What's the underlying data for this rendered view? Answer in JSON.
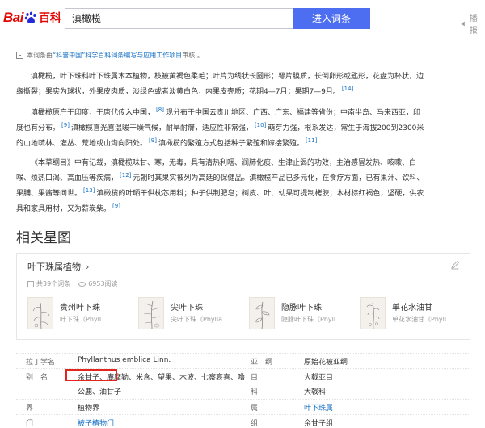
{
  "header": {
    "logo_bai": "Bai",
    "logo_du": "du",
    "logo_baike": "百科",
    "search_value": "滇橄榄",
    "search_button": "进入词条",
    "listen_label": "播报"
  },
  "notice": {
    "prefix": "本词条由",
    "org": "“科普中国”科学百科词条编写与应用工作项目",
    "suffix": " 审核 。"
  },
  "paragraphs": [
    {
      "lines": [
        {
          "text": "滇橄榄，叶下珠科叶下珠属木本植物，枝被黄褐色柔毛；叶片为线状长圆形；萼片膜质，长倒卵形或匙形，花盘为杯状，边"
        },
        {
          "text": "缘撕裂；果实为球状，外果皮肉质，淡绿色或者淡黄白色，内果皮壳质；花期4—7月；果期7—9月。",
          "ref": "[14]"
        }
      ]
    },
    {
      "lines": [
        {
          "text": "滇橄榄原产于印度，于唐代传入中国，",
          "ref": "[8]",
          "after": "现分布于中国云贵川地区、广西、广东、福建等省份；中南半岛、马来西亚，印"
        },
        {
          "text": "度也有分布。",
          "ref": "[9]",
          "after": "滇橄榄喜光喜温暖干燥气候，耐旱耐瘠，适应性非常强，",
          "ref2": "[10]",
          "after2": "萌芽力强，根系发达，常生于海拔200到2300米"
        },
        {
          "text": "的山地疏林、灌丛、荒地或山沟向阳处。",
          "ref": "[9]",
          "after": "滇橄榄的繁殖方式包括种子繁殖和嫁接繁殖。",
          "ref2": "[11]"
        }
      ]
    },
    {
      "lines": [
        {
          "text": "《本草纲目》中有记载，滇橄榄味甘、寒，无毒，具有清热利咽、润肺化痰、生津止渴的功效，主治感冒发热、咳嗽、白"
        },
        {
          "text": "喉、烦热口渴、高血压等疾病，",
          "ref": "[12]",
          "after": "元朝时其果实被列为高廷的保健品。滇橄榄产品已多元化，在食疗方面，已有果汁、饮料、"
        },
        {
          "text": "果脯、果酱等问世。",
          "ref": "[13]",
          "after": "滇橄榄的叶晒干供枕芯用料；种子供制肥皂；树皮、叶、幼果可提制栲胶；木材棕红褐色，坚硬，供农"
        },
        {
          "text": "具和家具用材，又为薪炭柴。",
          "ref": "[9]"
        }
      ]
    }
  ],
  "related": {
    "section_title": "相关星图",
    "card_title": "叶下珠属植物",
    "chevron": "›",
    "entry_count": "共39个词条",
    "view_count": "6953阅读",
    "plants": [
      {
        "name": "贵州叶下珠",
        "sub": "叶下珠（Phyll..."
      },
      {
        "name": "尖叶下珠",
        "sub": "尖叶下珠（Phylla..."
      },
      {
        "name": "隐脉叶下珠",
        "sub": "隐脉叶下珠（Phyll..."
      },
      {
        "name": "单花水油甘",
        "sub": "单花水油甘（Phyll..."
      }
    ]
  },
  "table": {
    "rows": [
      {
        "k1": "拉丁学名",
        "v1": "Phyllanthus emblica Linn.",
        "k2": "亚　纲",
        "v2": "原始花被亚纲"
      },
      {
        "k1": "别　名",
        "v1": "余甘子、庵摩勒、米含、望果、木波、七察哀喜、噜",
        "k2": "目",
        "v2": "大戟亚目"
      },
      {
        "k1": "",
        "v1": "公鹿、油甘子",
        "k2": "科",
        "v2": "大戟科"
      },
      {
        "k1": "界",
        "v1": "植物界",
        "k2": "属",
        "v2": "叶下珠属"
      },
      {
        "k1": "门",
        "v1": "被子植物门",
        "k2": "组",
        "v2": "余甘子组"
      }
    ]
  },
  "colors": {
    "brand_red": "#e10601",
    "brand_blue": "#2529d8",
    "search_button": "#4e6ef2",
    "link": "#136ec2",
    "highlight_box": "#e3261d"
  }
}
